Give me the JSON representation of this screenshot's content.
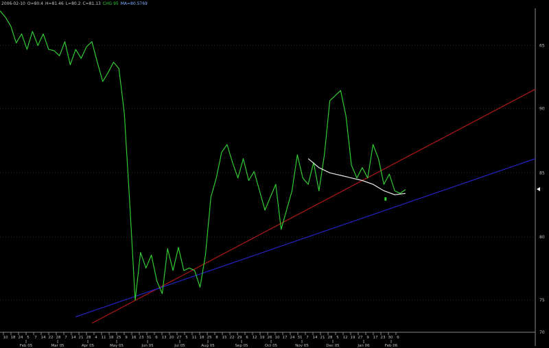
{
  "header": {
    "date": "2006-02-10",
    "open": "O=80.4",
    "high": "H=81.46",
    "low": "L=80.2",
    "close": "C=81.13",
    "indicator": "CHG 95",
    "ma": "MA=80.5769"
  },
  "colors": {
    "background": "#000000",
    "price": "#31cc31",
    "red_trend": "#b01818",
    "blue_trend": "#2424c8",
    "moving_average": "#e8e8e8",
    "grid": "#2a2a2a",
    "text": "#c8c8c8",
    "header_indicator": "#31cc31",
    "header_ma": "#7fb0ff"
  },
  "chart_data": {
    "type": "line",
    "title": "",
    "xlabel": "",
    "ylabel": "",
    "y_ticks": [
      "65",
      "90",
      "85",
      "80",
      "75",
      "70"
    ],
    "day_ticks": [
      "10",
      "18",
      "24",
      "5",
      "7",
      "14",
      "22",
      "28",
      "7",
      "14",
      "21",
      "28",
      "4",
      "11",
      "18",
      "25",
      "9",
      "16",
      "23",
      "31",
      "6",
      "13",
      "20",
      "27",
      "5",
      "11",
      "18",
      "25",
      "8",
      "15",
      "22",
      "29",
      "6",
      "12",
      "19",
      "26",
      "10",
      "17",
      "24",
      "31",
      "7",
      "14",
      "21",
      "28",
      "5",
      "12",
      "19",
      "27",
      "9",
      "17",
      "23",
      "30",
      "6"
    ],
    "month_ticks": [
      "Feb 05",
      "Mar 05",
      "Apr 05",
      "May 05",
      "Jun 05",
      "Jul 05",
      "Aug 05",
      "Sep 05",
      "Oct 05",
      "Nov 05",
      "Dec 05",
      "Jan 06",
      "Feb 06"
    ],
    "ylim": [
      70,
      95.2
    ],
    "grid": true,
    "series": [
      {
        "kind": "price",
        "values": [
          [
            0,
            95.0
          ],
          [
            1,
            94.5
          ],
          [
            2,
            93.8
          ],
          [
            3,
            92.5
          ],
          [
            4,
            93.2
          ],
          [
            5,
            92.0
          ],
          [
            6,
            93.4
          ],
          [
            7,
            92.3
          ],
          [
            8,
            93.2
          ],
          [
            9,
            92.0
          ],
          [
            10,
            91.9
          ],
          [
            11,
            91.5
          ],
          [
            12,
            92.6
          ],
          [
            13,
            90.8
          ],
          [
            14,
            92.0
          ],
          [
            15,
            91.3
          ],
          [
            16,
            92.2
          ],
          [
            17,
            92.6
          ],
          [
            18,
            91.0
          ],
          [
            19,
            89.5
          ],
          [
            20,
            90.2
          ],
          [
            21,
            91.0
          ],
          [
            22,
            90.5
          ],
          [
            23,
            87.0
          ],
          [
            24,
            80.0
          ],
          [
            25,
            72.5
          ],
          [
            26,
            76.2
          ],
          [
            27,
            75.0
          ],
          [
            28,
            76.0
          ],
          [
            29,
            74.0
          ],
          [
            30,
            73.0
          ],
          [
            31,
            76.5
          ],
          [
            32,
            74.8
          ],
          [
            33,
            76.6
          ],
          [
            34,
            74.8
          ],
          [
            35,
            75.0
          ],
          [
            36,
            74.8
          ],
          [
            37,
            73.5
          ],
          [
            38,
            76.0
          ],
          [
            39,
            80.5
          ],
          [
            40,
            82.0
          ],
          [
            41,
            84.0
          ],
          [
            42,
            84.6
          ],
          [
            43,
            83.2
          ],
          [
            44,
            82.0
          ],
          [
            45,
            83.5
          ],
          [
            46,
            81.8
          ],
          [
            47,
            82.5
          ],
          [
            48,
            81.0
          ],
          [
            49,
            79.5
          ],
          [
            50,
            80.5
          ],
          [
            51,
            81.5
          ],
          [
            52,
            78.0
          ],
          [
            53,
            79.5
          ],
          [
            54,
            81.0
          ],
          [
            55,
            83.8
          ],
          [
            56,
            82.0
          ],
          [
            57,
            81.5
          ],
          [
            58,
            83.2
          ],
          [
            59,
            81.0
          ],
          [
            60,
            83.8
          ],
          [
            61,
            88.0
          ],
          [
            62,
            88.4
          ],
          [
            63,
            88.8
          ],
          [
            64,
            86.8
          ],
          [
            65,
            83.0
          ],
          [
            66,
            82.0
          ],
          [
            67,
            82.8
          ],
          [
            68,
            82.0
          ],
          [
            69,
            84.6
          ],
          [
            70,
            83.5
          ],
          [
            71,
            81.5
          ],
          [
            72,
            82.3
          ],
          [
            73,
            81.0
          ],
          [
            74,
            80.8
          ],
          [
            75,
            81.1
          ]
        ]
      },
      {
        "kind": "moving_average",
        "values": [
          [
            57,
            83.5
          ],
          [
            59,
            82.8
          ],
          [
            61,
            82.4
          ],
          [
            63,
            82.2
          ],
          [
            65,
            82.0
          ],
          [
            67,
            81.8
          ],
          [
            69,
            81.5
          ],
          [
            71,
            81.0
          ],
          [
            73,
            80.7
          ],
          [
            75,
            80.8
          ]
        ]
      },
      {
        "kind": "trendline",
        "color_key": "red_trend",
        "values": [
          [
            17,
            70.7
          ],
          [
            99,
            88.9
          ]
        ]
      },
      {
        "kind": "trendline",
        "color_key": "blue_trend",
        "values": [
          [
            14,
            71.2
          ],
          [
            99,
            83.5
          ]
        ]
      }
    ]
  }
}
